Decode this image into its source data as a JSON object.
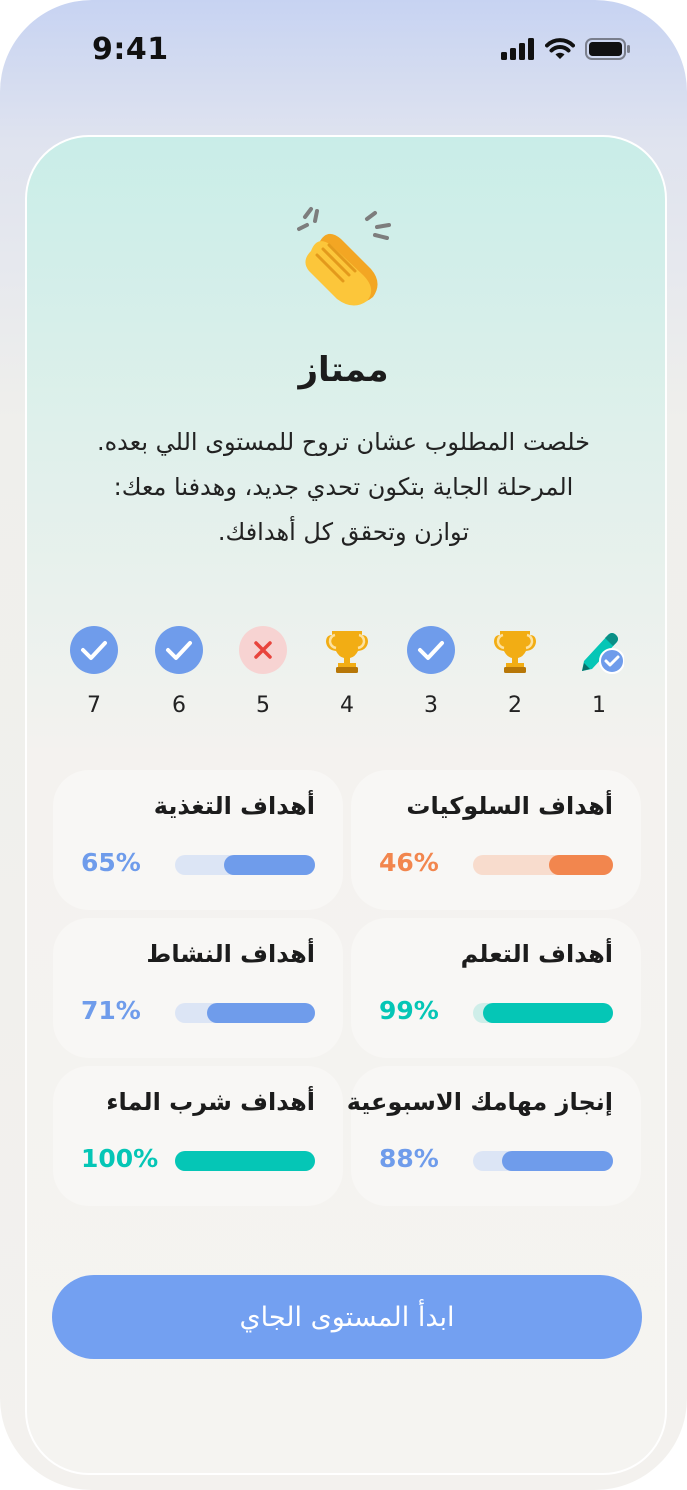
{
  "status_bar": {
    "time": "9:41",
    "icons": [
      "signal-icon",
      "wifi-icon",
      "battery-icon"
    ]
  },
  "hero": {
    "icon": "clapping-hands-icon",
    "title": "ممتاز",
    "description": [
      "خلصت المطلوب عشان تروح للمستوى اللي بعده.",
      "المرحلة الجاية بتكون تحدي جديد، وهدفنا معك:",
      "توازن وتحقق كل أهدافك."
    ]
  },
  "steps": [
    {
      "number": "1",
      "status": "in-progress"
    },
    {
      "number": "2",
      "status": "trophy"
    },
    {
      "number": "3",
      "status": "done"
    },
    {
      "number": "4",
      "status": "trophy"
    },
    {
      "number": "5",
      "status": "failed"
    },
    {
      "number": "6",
      "status": "done"
    },
    {
      "number": "7",
      "status": "done"
    }
  ],
  "goals": [
    {
      "title": "أهداف السلوكيات",
      "percent_label": "46%",
      "progress": 0.46,
      "color": "#f2864e",
      "track": "#f8dccd"
    },
    {
      "title": "أهداف التغذية",
      "percent_label": "65%",
      "progress": 0.65,
      "color": "#6f9ceb",
      "track": "#dce5f5"
    },
    {
      "title": "أهداف التعلم",
      "percent_label": "99%",
      "progress": 0.93,
      "color": "#05c6b6",
      "track": "#cfeee9"
    },
    {
      "title": "أهداف النشاط",
      "percent_label": "71%",
      "progress": 0.77,
      "color": "#6f9ceb",
      "track": "#dce5f5"
    },
    {
      "title": "إنجاز مهامك الاسبوعية",
      "percent_label": "88%",
      "progress": 0.79,
      "color": "#6f9ceb",
      "track": "#dce5f5"
    },
    {
      "title": "أهداف شرب الماء",
      "percent_label": "100%",
      "progress": 1.0,
      "color": "#05c6b6",
      "track": "#cfeee9"
    }
  ],
  "colors": {
    "accent_blue": "#6f9ceb",
    "accent_teal": "#05c6b6",
    "accent_orange": "#f2864e",
    "cta_bg": "#73a0f1"
  },
  "cta": {
    "label": "ابدأ المستوى الجاي"
  }
}
